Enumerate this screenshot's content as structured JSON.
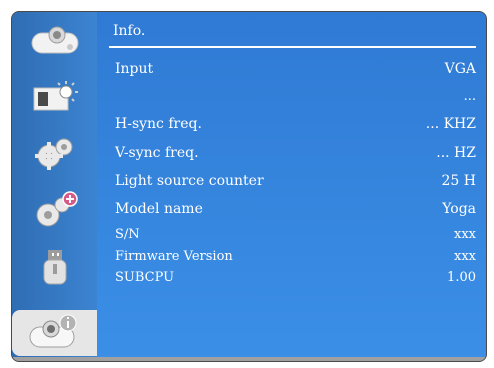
{
  "window": {
    "title": "Info."
  },
  "sidebar": {
    "items": [
      {
        "name": "projector-picture",
        "icon": "projector-icon"
      },
      {
        "name": "display",
        "icon": "image-sun-icon"
      },
      {
        "name": "setup",
        "icon": "gears-icon"
      },
      {
        "name": "expansion-setup",
        "icon": "gears-plus-icon"
      },
      {
        "name": "usb",
        "icon": "usb-drive-icon"
      },
      {
        "name": "info",
        "icon": "projector-info-icon",
        "active": true
      }
    ]
  },
  "info": {
    "rows": [
      {
        "label": "Input",
        "value": "VGA"
      },
      {
        "label": "",
        "value": "..."
      },
      {
        "label": "H-sync freq.",
        "value": "... KHZ"
      },
      {
        "label": "V-sync freq.",
        "value": "... HZ"
      },
      {
        "label": "Light source counter",
        "value": "25  H"
      },
      {
        "label": "Model name",
        "value": "Yoga"
      },
      {
        "label": "S/N",
        "value": "xxx"
      },
      {
        "label": "Firmware Version",
        "value": "xxx"
      },
      {
        "label": "SUBCPU",
        "value": "1.00"
      }
    ]
  },
  "colors": {
    "sidebar": "#3c84d2",
    "main": "#2f7ad4",
    "active_tab": "#e6e6e6",
    "text": "#ffffff"
  }
}
